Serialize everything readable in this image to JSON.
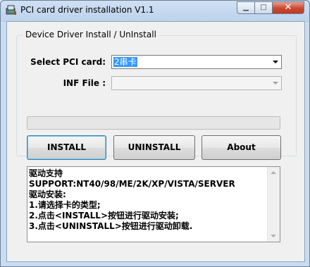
{
  "window": {
    "title": "PCI card driver installation V1.1",
    "min_glyph": "▁",
    "max_glyph": "□",
    "close_glyph": "✕"
  },
  "group": {
    "title": "Device Driver Install / UnInstall"
  },
  "select_pci": {
    "label": "Select PCI card:",
    "value": "2串卡"
  },
  "inf_file": {
    "label": "INF File :",
    "value": ""
  },
  "progress": {
    "value": 0
  },
  "buttons": {
    "install": "INSTALL",
    "uninstall": "UNINSTALL",
    "about": "About"
  },
  "info_text": {
    "lines": [
      "驱动支持",
      "SUPPORT:NT40/98/ME/2K/XP/VISTA/SERVER",
      "驱动安装:",
      "1.请选择卡的类型;",
      "2.点击<INSTALL>按钮进行驱动安装;",
      "3.点击<UNINSTALL>按钮进行驱动卸载."
    ]
  },
  "colors": {
    "selection": "#3399ff",
    "close_button": "#c9482f",
    "frame": "#bcd2ec"
  }
}
